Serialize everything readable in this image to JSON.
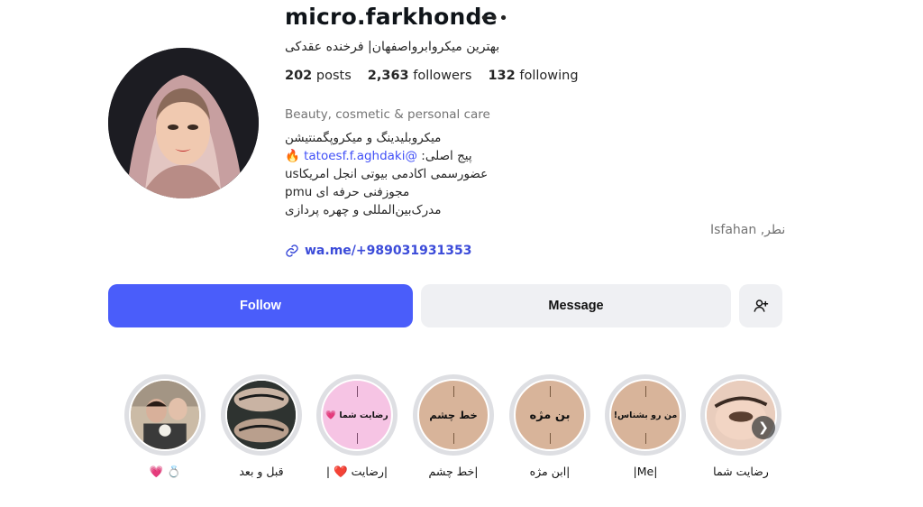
{
  "profile": {
    "username": "micro.farkhonde",
    "full_name": "بهترین میکروابرواصفهان| فرخنده عقدکی",
    "stats": {
      "posts_count": "202",
      "posts_label": "posts",
      "followers_count": "2,363",
      "followers_label": "followers",
      "following_count": "132",
      "following_label": "following"
    },
    "category": "Beauty, cosmetic & personal care",
    "bio_lines": [
      "میکروبلیدینگ و میکروپگمنتیشن",
      "پیج اصلی:",
      "عضورسمی اکادمی بیوتی انجل امریکاus",
      "مجوزفنی حرفه ای pmu",
      "مدرک‌بین‌المللی و چهره پردازی"
    ],
    "bio_mention": "tatoesf.f.aghdaki@",
    "bio_fire_emoji": "🔥",
    "location": "Isfahan ,نطر",
    "link": "wa.me/+989031931353"
  },
  "actions": {
    "follow": "Follow",
    "message": "Message"
  },
  "highlights": [
    {
      "label": "رضایت شما",
      "cover_text": ""
    },
    {
      "label": "|Me|",
      "cover_text": "من رو بشناس!"
    },
    {
      "label": "|ابن مژه",
      "cover_text": "بن مژه"
    },
    {
      "label": "|خط چشم",
      "cover_text": "خط چشم"
    },
    {
      "label": "|رضایت ❤️ |",
      "cover_text": "رضایت شما 💗"
    },
    {
      "label": "قبل و بعد",
      "cover_text": ""
    },
    {
      "label": "💍 💗",
      "cover_text": ""
    }
  ],
  "colors": {
    "follow_bg": "#4a5dfa",
    "secondary_bg": "#eff0f3",
    "link": "#3b4bd9",
    "highlight_tan": "#d8b49a",
    "highlight_pink": "#f6c4e4"
  },
  "icons": [
    "more-icon",
    "link-icon",
    "add-user-icon",
    "chevron-right-icon",
    "fire-icon"
  ]
}
